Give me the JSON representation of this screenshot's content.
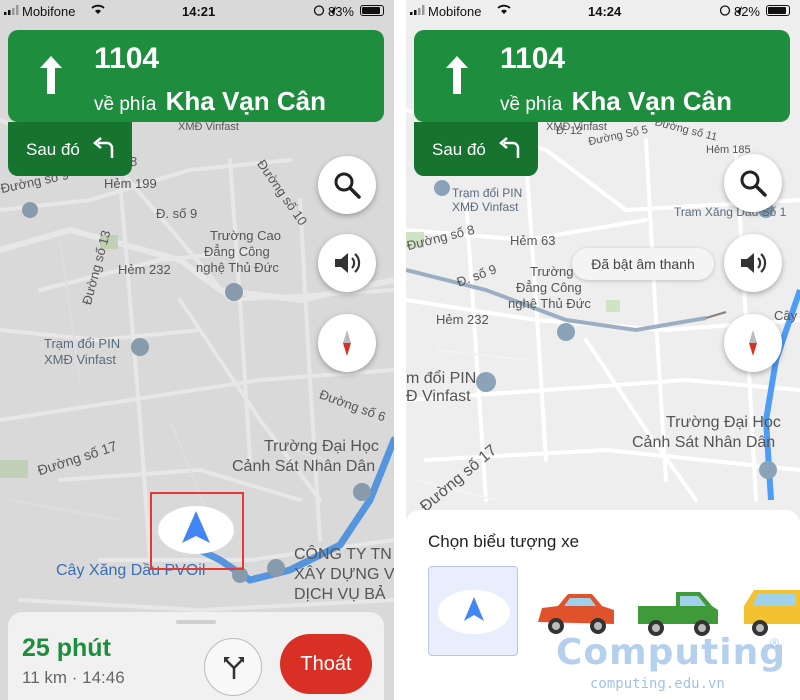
{
  "screens": [
    {
      "status": {
        "carrier": "Mobifone",
        "time": "14:21",
        "battery": "83%"
      },
      "banner": {
        "road_number": "1104",
        "toward_prefix": "về phía",
        "street": "Kha Vạn Cân"
      },
      "then_label": "Sau đó",
      "map_labels": {
        "xmd_vinfast_top": "XMĐ Vinfast",
        "hem_199": "Hẻm 199",
        "duong_so_9_left": "Đường số 9",
        "duong_so_10": "Đường số 10",
        "d_so_9": "Đ. số 9",
        "truong_cao_1": "Trường Cao",
        "truong_cao_2": "Đẳng Công",
        "truong_cao_3": "nghệ Thủ Đức",
        "duong_so_13": "Đường số 13",
        "hem_232": "Hẻm 232",
        "tram_pin_1": "Trạm đổi PIN",
        "tram_pin_2": "XMĐ Vinfast",
        "duong_so_6": "Đường số 6",
        "duong_so_17": "Đường số 17",
        "truong_dai_hoc_1": "Trường Đại Học",
        "truong_dai_hoc_2": "Cảnh Sát Nhân Dân",
        "cay_xang": "Cây Xăng Dầu PVOil",
        "cong_ty_1": "CÔNG TY TN",
        "cong_ty_2": "XÂY DỰNG V",
        "cong_ty_3": "DỊCH VỤ BẢ",
        "num_8": "8"
      },
      "eta": {
        "time": "25 phút",
        "detail": "11 km · 14:46"
      },
      "exit_label": "Thoát"
    },
    {
      "status": {
        "carrier": "Mobifone",
        "time": "14:24",
        "battery": "82%"
      },
      "banner": {
        "road_number": "1104",
        "toward_prefix": "về phía",
        "street": "Kha Vạn Cân"
      },
      "then_label": "Sau đó",
      "sound_toast": "Đã bật âm thanh",
      "map_labels": {
        "xmd_vinfast_top": "XMĐ Vinfast",
        "d_12": "Đ. 12",
        "duong_so_5": "Đường Số 5",
        "duong_so_11": "Đường số 11",
        "hem_185": "Hẻm 185",
        "tram_pin_1": "Trạm đổi PIN",
        "tram_pin_2": "XMĐ Vinfast",
        "tram_xang": "Tram Xăng Dầu Số 1",
        "duong_so_8": "Đường số 8",
        "hem_63": "Hẻm 63",
        "d_so_9": "Đ. số 9",
        "truong_cao_1": "Trường Ca",
        "truong_cao_2": "Đẳng Công",
        "truong_cao_3": "nghệ Thủ Đức",
        "hem_232": "Hẻm 232",
        "cay": "Cây",
        "doi_pin": "m đổi PIN",
        "d_vinfast": "Đ Vinfast",
        "truong_dai_hoc_1": "Trường Đại Học",
        "truong_dai_hoc_2": "Cảnh Sát Nhân Dân",
        "duong_so_17": "Đường số 17"
      },
      "chooser_title": "Chọn biểu tượng xe"
    }
  ],
  "watermark": {
    "main": "Computing",
    "reg": "®",
    "url": "computing.edu.vn"
  },
  "colors": {
    "nav_green": "#1e8e3e",
    "nav_green_dark": "#16742f",
    "exit_red": "#d93025",
    "arrow_blue": "#4285f4",
    "highlight_red": "#e53935"
  },
  "icons": [
    "up-arrow-icon",
    "turn-left-icon",
    "search-icon",
    "speaker-icon",
    "compass-icon",
    "route-options-icon",
    "navigation-arrow-icon",
    "ev-charging-icon",
    "school-icon",
    "gas-station-icon"
  ]
}
